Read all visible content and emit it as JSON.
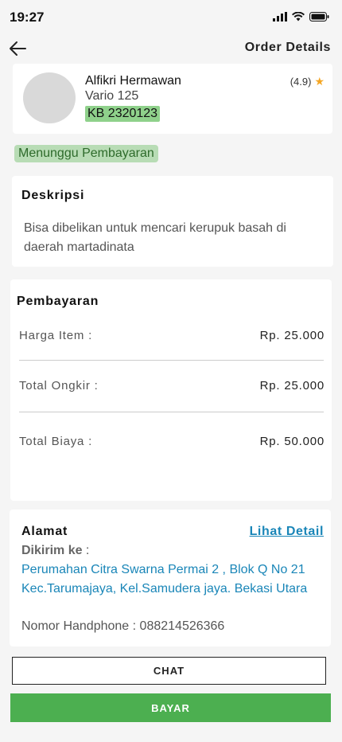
{
  "status_bar": {
    "time": "19:27"
  },
  "header": {
    "title": "Order Details"
  },
  "driver": {
    "name": "Alfikri Hermawan",
    "vehicle": "Vario 125",
    "plate": "KB 2320123",
    "rating": "(4.9)"
  },
  "order_status": "Menunggu Pembayaran",
  "description": {
    "title": "Deskripsi",
    "text": "Bisa dibelikan untuk mencari kerupuk basah di daerah martadinata"
  },
  "payment": {
    "title": "Pembayaran",
    "rows": [
      {
        "label": "Harga Item :",
        "value": "Rp. 25.000"
      },
      {
        "label": "Total Ongkir :",
        "value": "Rp. 25.000"
      },
      {
        "label": "Total Biaya :",
        "value": "Rp. 50.000"
      }
    ]
  },
  "address": {
    "title": "Alamat",
    "detail_link": "Lihat Detail",
    "sent_to_label": "Dikirim ke",
    "sent_to_suffix": " :",
    "text": "Perumahan Citra Swarna Permai 2 , Blok Q No 21 Kec.Tarumajaya, Kel.Samudera jaya. Bekasi Utara",
    "phone_label": "Nomor Handphone :",
    "phone": "088214526366"
  },
  "buttons": {
    "chat": "CHAT",
    "pay": "BAYAR"
  },
  "colors": {
    "accent_green": "#4caf50",
    "link_blue": "#1a86b8",
    "star": "#f5a623"
  },
  "icons": [
    "signal-icon",
    "wifi-icon",
    "battery-icon",
    "back-arrow-icon",
    "star-icon"
  ]
}
